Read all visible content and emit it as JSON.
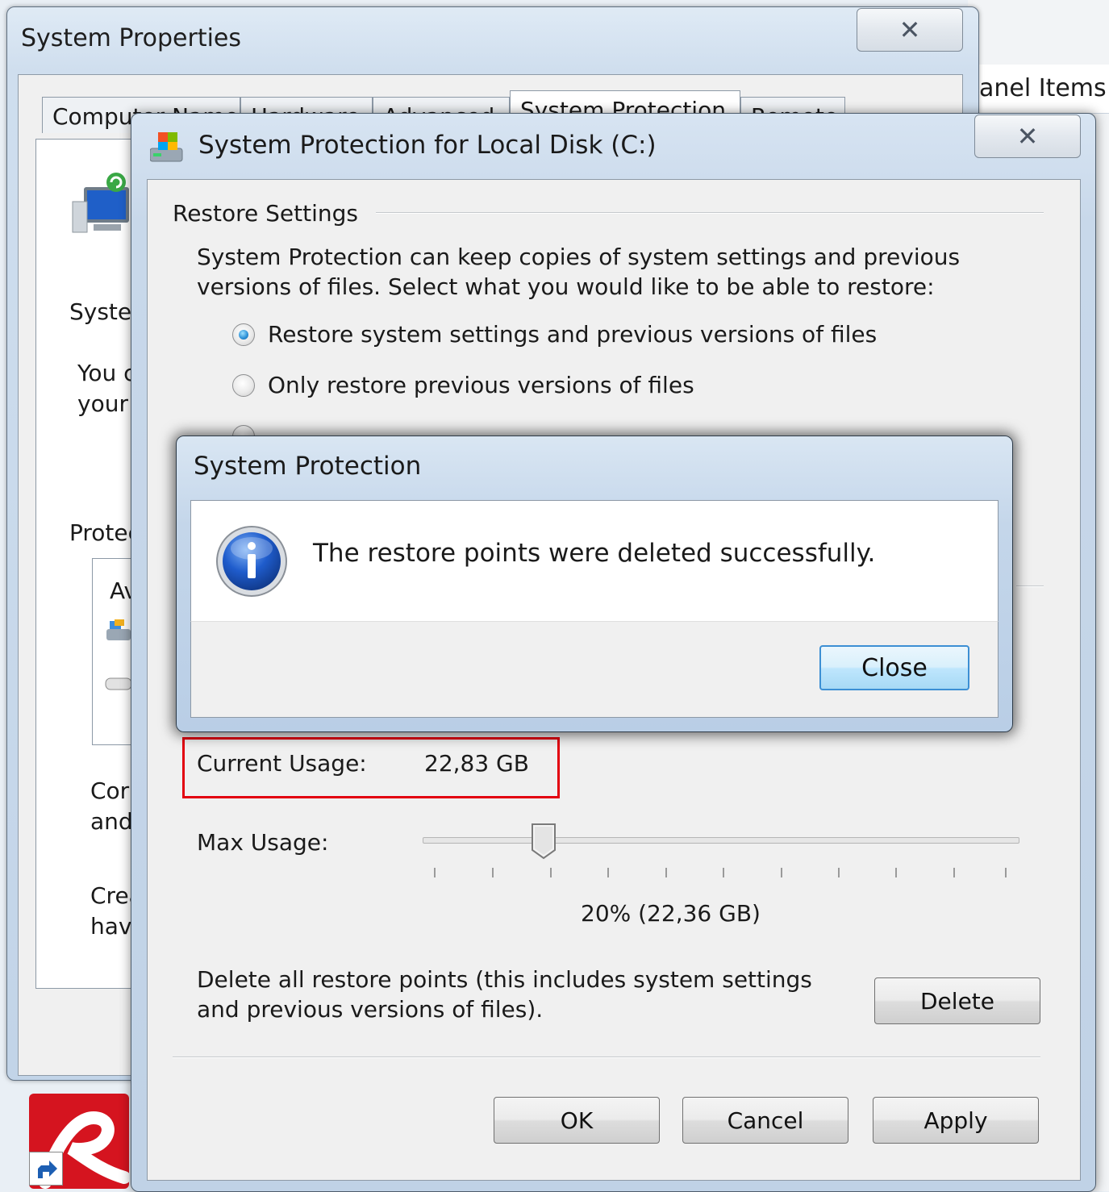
{
  "desktop": {
    "control_panel_fragment": "anel Items"
  },
  "system_properties": {
    "title": "System Properties",
    "close_glyph": "✕",
    "tabs": [
      {
        "label": "Computer Name"
      },
      {
        "label": "Hardware"
      },
      {
        "label": "Advanced"
      },
      {
        "label": "System Protection"
      },
      {
        "label": "Remote"
      }
    ],
    "bg_fragments": {
      "system": "System",
      "you_line1": "You c",
      "you_line2": "your c",
      "protection": "Protec",
      "list_header": "Av",
      "configure_line1": "Cor",
      "configure_line2": "and",
      "create_line1": "Crea",
      "create_line2": "hav"
    }
  },
  "sp_dialog": {
    "title": "System Protection for Local Disk (C:)",
    "close_glyph": "✕",
    "restore_settings": {
      "group_label": "Restore Settings",
      "description_line1": "System Protection can keep copies of system settings and previous",
      "description_line2": "versions of files. Select what you would like to be able to restore:",
      "options": [
        {
          "label": "Restore system settings and previous versions of files",
          "selected": true
        },
        {
          "label": "Only restore previous versions of files",
          "selected": false
        }
      ]
    },
    "disk_space": {
      "current_usage_label": "Current Usage:",
      "current_usage_value": "22,83 GB",
      "max_usage_label": "Max Usage:",
      "max_usage_value": "20% (22,36 GB)",
      "slider_fraction": 0.2,
      "delete_text_line1": "Delete all restore points (this includes system settings",
      "delete_text_line2": "and previous versions of files).",
      "delete_button": "Delete"
    },
    "buttons": {
      "ok": "OK",
      "cancel": "Cancel",
      "apply": "Apply"
    }
  },
  "message_box": {
    "title": "System Protection",
    "icon": "info-icon",
    "message": "The restore points were deleted successfully.",
    "close_button": "Close"
  },
  "colors": {
    "highlight_box": "#e30010",
    "avira_red": "#d5141f"
  }
}
